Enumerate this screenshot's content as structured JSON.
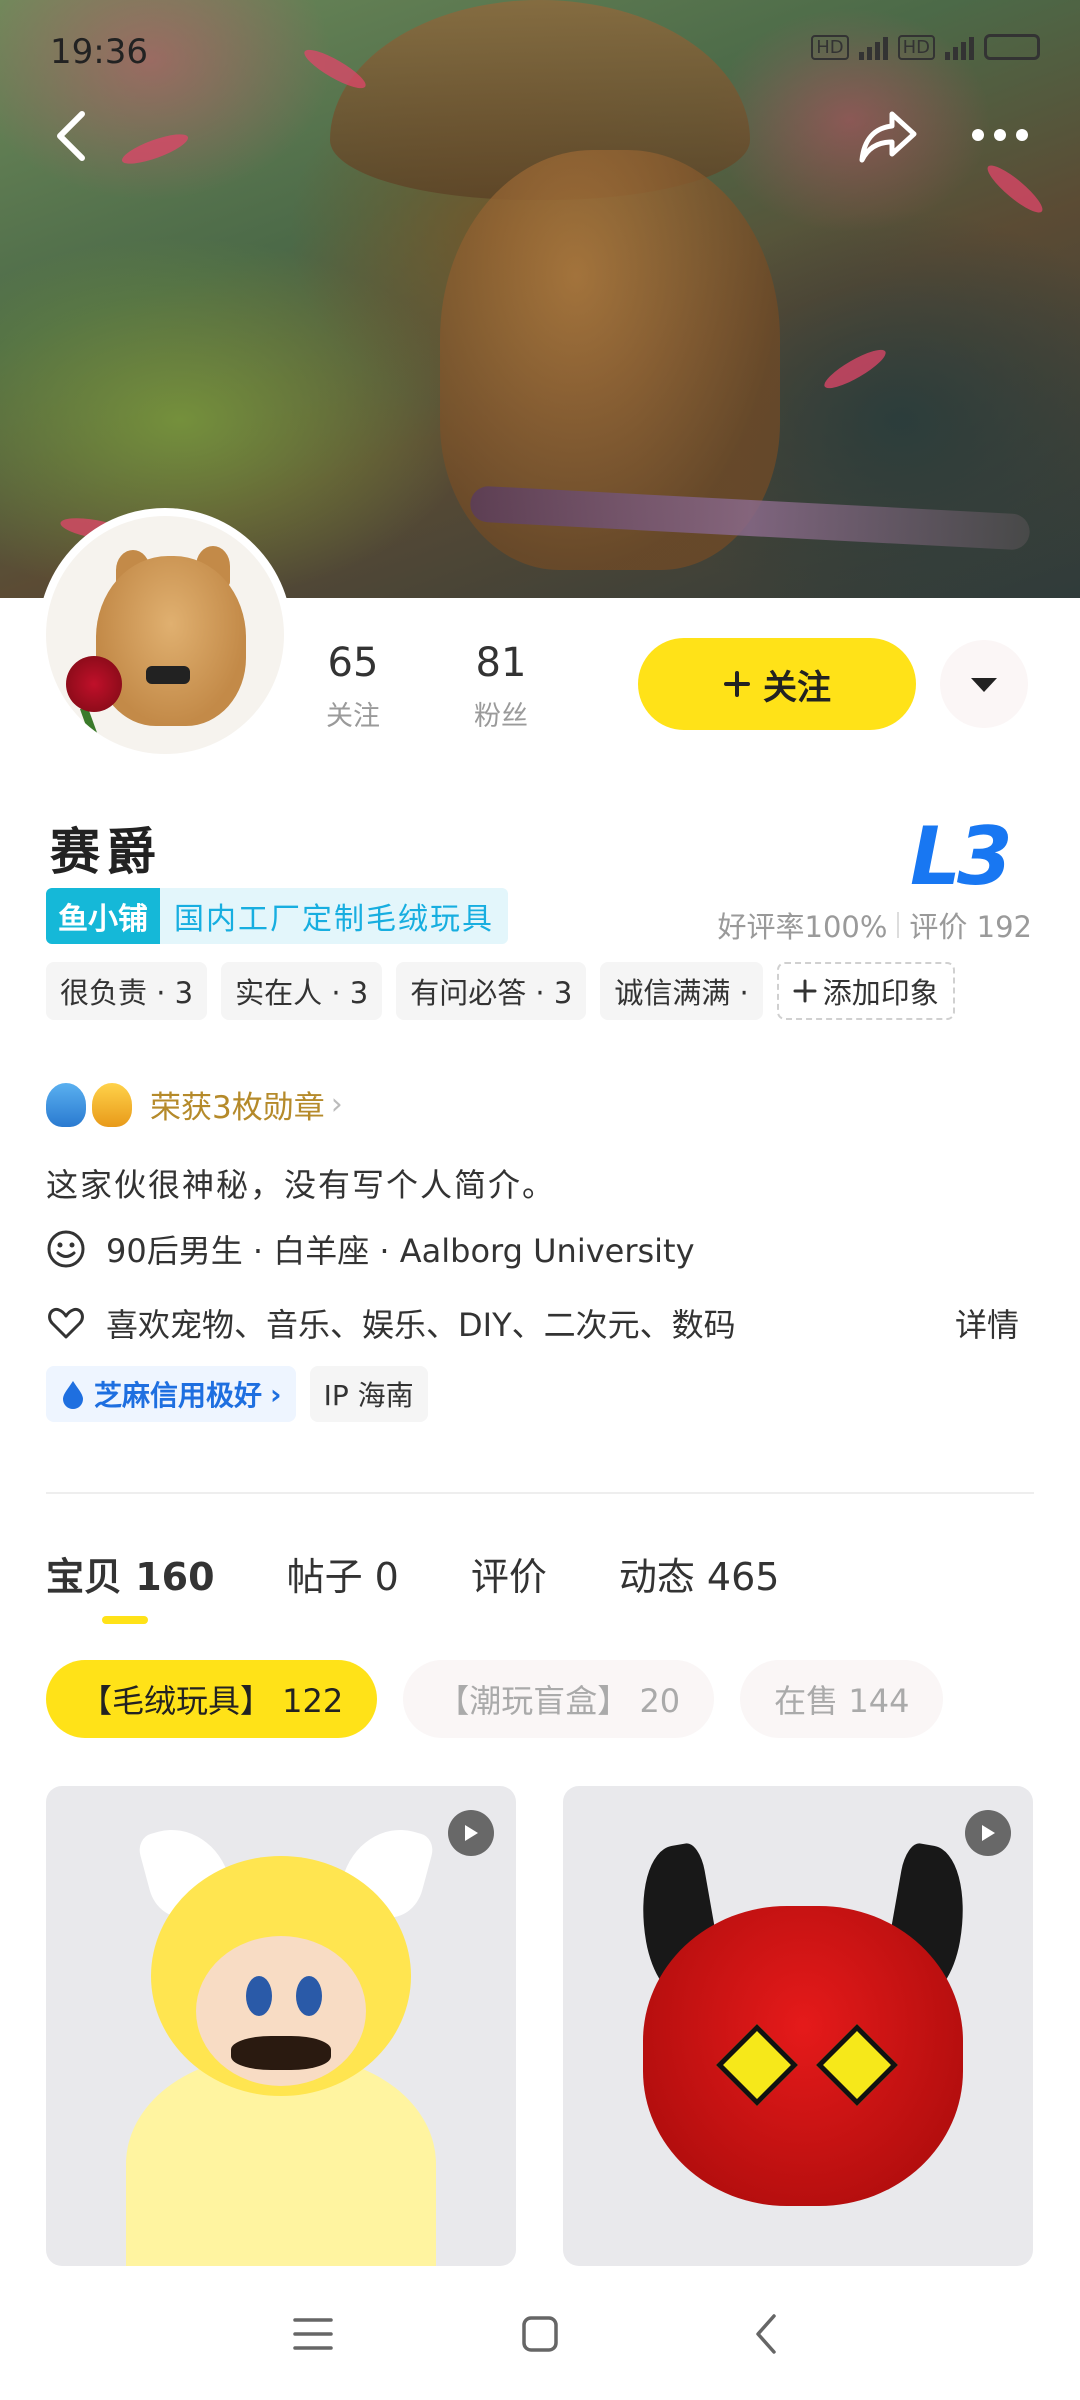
{
  "status_bar": {
    "time": "19:36",
    "badge_hd1": "HD",
    "badge_hd2": "HD"
  },
  "profile": {
    "following_count": "65",
    "following_label": "关注",
    "followers_count": "81",
    "followers_label": "粉丝",
    "follow_button_label": "关注",
    "name": "赛爵",
    "level": "L3",
    "shop_tag_label": "鱼小铺",
    "shop_tag_desc": "国内工厂定制毛绒玩具",
    "good_rate": "好评率100%",
    "review_count": "评价 192"
  },
  "impressions": [
    "很负责 · 3",
    "实在人 · 3",
    "有问必答 · 3",
    "诚信满满 ·"
  ],
  "add_impression_label": "添加印象",
  "medals_text": "荣获3枚勋章",
  "bio": "这家伙很神秘，没有写个人简介。",
  "personal_info": "90后男生 · 白羊座 · Aalborg University",
  "interests": "喜欢宠物、音乐、娱乐、DIY、二次元、数码",
  "details_label": "详情",
  "sesame_credit": "芝麻信用极好",
  "ip_label": "IP 海南",
  "tabs": [
    {
      "label": "宝贝 160",
      "active": true
    },
    {
      "label": "帖子 0",
      "active": false
    },
    {
      "label": "评价",
      "active": false
    },
    {
      "label": "动态 465",
      "active": false
    }
  ],
  "chips": [
    {
      "label": "【毛绒玩具】 122",
      "active": true
    },
    {
      "label": "【潮玩盲盒】 20",
      "active": false
    },
    {
      "label": "在售 144",
      "active": false
    }
  ],
  "colors": {
    "accent_yellow": "#ffe218",
    "level_blue": "#1877f2",
    "shop_cyan": "#15b8d8",
    "medal_gold": "#b58a2a"
  },
  "icons": {
    "back": "chevron-left-icon",
    "share": "share-arrow-icon",
    "more": "more-dots-icon",
    "dropdown": "caret-down-icon",
    "smile": "smile-face-icon",
    "heart": "heart-outline-icon",
    "sesame": "drop-icon",
    "play": "play-icon",
    "menu": "menu-icon",
    "home": "square-home-icon",
    "sys_back": "triangle-back-icon"
  }
}
